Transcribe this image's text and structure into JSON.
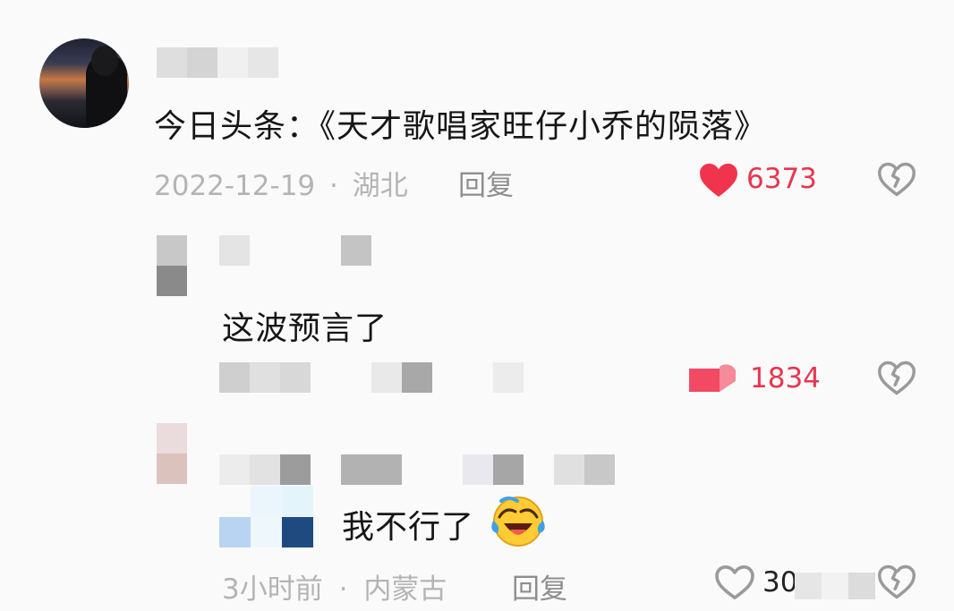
{
  "comments": [
    {
      "text": "今日头条：《天才歌唱家旺仔小乔的陨落》",
      "date": "2022-12-19",
      "separator": "·",
      "location": "湖北",
      "reply_label": "回复",
      "like_count": "6373",
      "liked": true
    },
    {
      "text": "这波预言了",
      "like_count": "1834",
      "liked": true
    },
    {
      "text": "我不行了",
      "emoji": "laughing-crying-emoji",
      "time": "3小时前",
      "separator": "·",
      "location": "内蒙古",
      "reply_label": "回复",
      "like_count": "30",
      "liked": false
    }
  ],
  "icons": {
    "like": "heart-icon",
    "dislike": "broken-heart-icon",
    "emoji": "laughing-crying-emoji"
  },
  "colors": {
    "like_active": "#f0344d",
    "meta_text": "#b4b4b4",
    "reply_text": "#8e8e8e",
    "icon_gray": "#9a9a9a"
  }
}
